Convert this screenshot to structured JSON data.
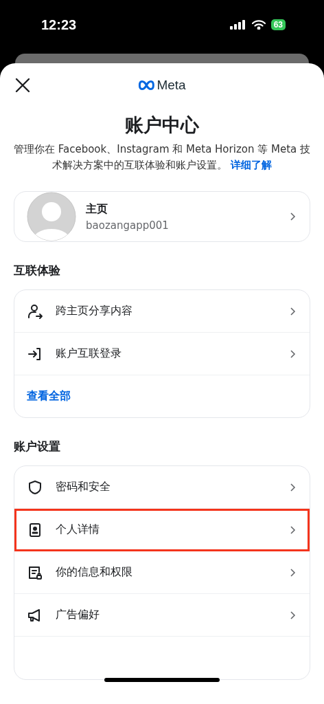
{
  "status_bar": {
    "time": "12:23",
    "battery": "63"
  },
  "header": {
    "logo_text": "Meta",
    "title": "账户中心",
    "description": "管理你在 Facebook、Instagram 和 Meta Horizon 等 Meta 技术解决方案中的互联体验和账户设置。",
    "learn_more": "详细了解"
  },
  "profile": {
    "label": "主页",
    "username": "baozangapp001"
  },
  "sections": [
    {
      "title": "互联体验",
      "items": [
        {
          "kind": "share",
          "label": "跨主页分享内容",
          "highlighted": false
        },
        {
          "kind": "login",
          "label": "账户互联登录",
          "highlighted": false
        }
      ],
      "see_all": "查看全部"
    },
    {
      "title": "账户设置",
      "items": [
        {
          "kind": "shield",
          "label": "密码和安全",
          "highlighted": false
        },
        {
          "kind": "id-card",
          "label": "个人详情",
          "highlighted": true
        },
        {
          "kind": "info-lock",
          "label": "你的信息和权限",
          "highlighted": false
        },
        {
          "kind": "megaphone",
          "label": "广告偏好",
          "highlighted": false
        }
      ]
    }
  ]
}
